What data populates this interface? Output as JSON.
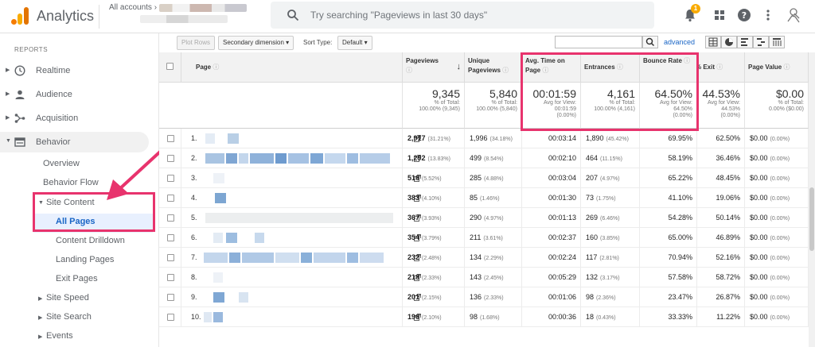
{
  "app": {
    "title": "Analytics",
    "accounts_label": "All accounts ›"
  },
  "search": {
    "placeholder": "Try searching \"Pageviews in last 30 days\""
  },
  "notifications": {
    "count": "1"
  },
  "sidebar": {
    "reports_label": "REPORTS",
    "items": [
      {
        "label": "Realtime",
        "icon": "clock-icon"
      },
      {
        "label": "Audience",
        "icon": "person-icon"
      },
      {
        "label": "Acquisition",
        "icon": "acquisition-icon"
      },
      {
        "label": "Behavior",
        "icon": "behavior-icon"
      }
    ],
    "behavior_sub": {
      "overview": "Overview",
      "behavior_flow": "Behavior Flow",
      "site_content": "Site Content",
      "all_pages": "All Pages",
      "content_drilldown": "Content Drilldown",
      "landing_pages": "Landing Pages",
      "exit_pages": "Exit Pages",
      "site_speed": "Site Speed",
      "site_search": "Site Search",
      "events": "Events"
    }
  },
  "toolbar": {
    "plot_rows": "Plot Rows",
    "secondary_dimension": "Secondary dimension",
    "sort_type_label": "Sort Type:",
    "sort_default": "Default",
    "advanced": "advanced"
  },
  "table": {
    "headers": {
      "page": "Page",
      "pageviews": "Pageviews",
      "unique_pageviews": "Unique Pageviews",
      "avg_time": "Avg. Time on Page",
      "entrances": "Entrances",
      "bounce_rate": "Bounce Rate",
      "exit": "% Exit",
      "page_value": "Page Value"
    },
    "totals": {
      "pageviews": {
        "value": "9,345",
        "l1": "% of Total:",
        "l2": "100.00% (9,345)",
        "l3": ""
      },
      "unique": {
        "value": "5,840",
        "l1": "% of Total:",
        "l2": "100.00% (5,840)",
        "l3": ""
      },
      "avg_time": {
        "value": "00:01:59",
        "l1": "Avg for View:",
        "l2": "00:01:59",
        "l3": "(0.00%)"
      },
      "entrances": {
        "value": "4,161",
        "l1": "% of Total:",
        "l2": "100.00% (4,161)",
        "l3": ""
      },
      "bounce": {
        "value": "64.50%",
        "l1": "Avg for View:",
        "l2": "64.50%",
        "l3": "(0.00%)"
      },
      "exit": {
        "value": "44.53%",
        "l1": "Avg for View:",
        "l2": "44.53%",
        "l3": "(0.00%)"
      },
      "page_value": {
        "value": "$0.00",
        "l1": "% of Total:",
        "l2": "0.00% ($0.00)",
        "l3": ""
      }
    },
    "rows": [
      {
        "n": "1.",
        "pv": "2,917",
        "pvp": "(31.21%)",
        "upv": "1,996",
        "upvp": "(34.18%)",
        "time": "00:03:14",
        "ent": "1,890",
        "entp": "(45.42%)",
        "bounce": "69.95%",
        "exit": "62.50%",
        "val": "$0.00",
        "valp": "(0.00%)"
      },
      {
        "n": "2.",
        "pv": "1,292",
        "pvp": "(13.83%)",
        "upv": "499",
        "upvp": "(8.54%)",
        "time": "00:02:10",
        "ent": "464",
        "entp": "(11.15%)",
        "bounce": "58.19%",
        "exit": "36.46%",
        "val": "$0.00",
        "valp": "(0.00%)"
      },
      {
        "n": "3.",
        "pv": "516",
        "pvp": "(5.52%)",
        "upv": "285",
        "upvp": "(4.88%)",
        "time": "00:03:04",
        "ent": "207",
        "entp": "(4.97%)",
        "bounce": "65.22%",
        "exit": "48.45%",
        "val": "$0.00",
        "valp": "(0.00%)"
      },
      {
        "n": "4.",
        "pv": "383",
        "pvp": "(4.10%)",
        "upv": "85",
        "upvp": "(1.46%)",
        "time": "00:01:30",
        "ent": "73",
        "entp": "(1.75%)",
        "bounce": "41.10%",
        "exit": "19.06%",
        "val": "$0.00",
        "valp": "(0.00%)"
      },
      {
        "n": "5.",
        "pv": "367",
        "pvp": "(3.93%)",
        "upv": "290",
        "upvp": "(4.97%)",
        "time": "00:01:13",
        "ent": "269",
        "entp": "(6.46%)",
        "bounce": "54.28%",
        "exit": "50.14%",
        "val": "$0.00",
        "valp": "(0.00%)"
      },
      {
        "n": "6.",
        "pv": "354",
        "pvp": "(3.79%)",
        "upv": "211",
        "upvp": "(3.61%)",
        "time": "00:02:37",
        "ent": "160",
        "entp": "(3.85%)",
        "bounce": "65.00%",
        "exit": "46.89%",
        "val": "$0.00",
        "valp": "(0.00%)"
      },
      {
        "n": "7.",
        "pv": "232",
        "pvp": "(2.48%)",
        "upv": "134",
        "upvp": "(2.29%)",
        "time": "00:02:24",
        "ent": "117",
        "entp": "(2.81%)",
        "bounce": "70.94%",
        "exit": "52.16%",
        "val": "$0.00",
        "valp": "(0.00%)"
      },
      {
        "n": "8.",
        "pv": "218",
        "pvp": "(2.33%)",
        "upv": "143",
        "upvp": "(2.45%)",
        "time": "00:05:29",
        "ent": "132",
        "entp": "(3.17%)",
        "bounce": "57.58%",
        "exit": "58.72%",
        "val": "$0.00",
        "valp": "(0.00%)"
      },
      {
        "n": "9.",
        "pv": "201",
        "pvp": "(2.15%)",
        "upv": "136",
        "upvp": "(2.33%)",
        "time": "00:01:06",
        "ent": "98",
        "entp": "(2.36%)",
        "bounce": "23.47%",
        "exit": "26.87%",
        "val": "$0.00",
        "valp": "(0.00%)"
      },
      {
        "n": "10.",
        "pv": "196",
        "pvp": "(2.10%)",
        "upv": "98",
        "upvp": "(1.68%)",
        "time": "00:00:36",
        "ent": "18",
        "entp": "(0.43%)",
        "bounce": "33.33%",
        "exit": "11.22%",
        "val": "$0.00",
        "valp": "(0.00%)"
      }
    ]
  },
  "colors": {
    "highlight": "#e8336d",
    "brand_orange": "#f9ab00",
    "link_blue": "#1a66c6",
    "redacted_blue": "#8fb6dc"
  }
}
